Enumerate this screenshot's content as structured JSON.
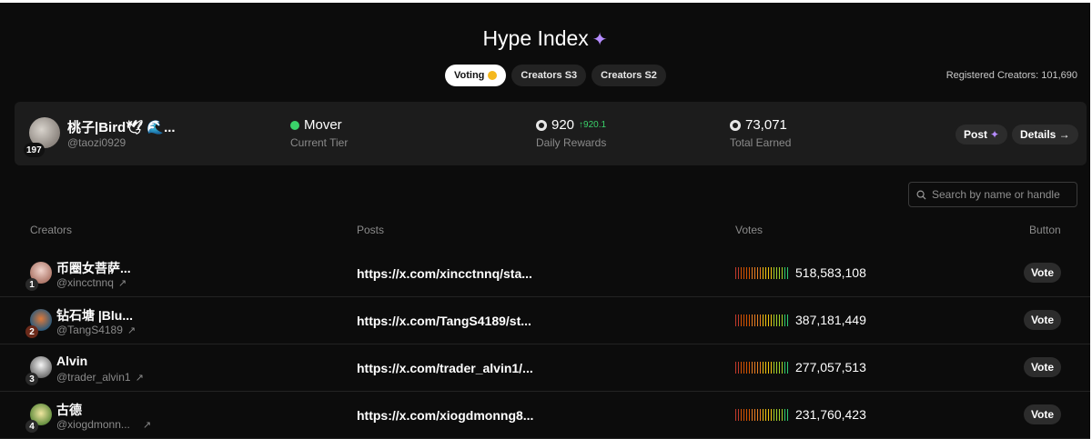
{
  "header": {
    "title": "Hype Index",
    "title_icon": "sparkle-icon"
  },
  "tabs": [
    {
      "label": "Voting",
      "active": true,
      "icon": "coin-icon"
    },
    {
      "label": "Creators S3",
      "active": false
    },
    {
      "label": "Creators S2",
      "active": false
    }
  ],
  "registered": "Registered Creators: 101,690",
  "profile": {
    "rank": "197",
    "name": "桃子|Bird🕊 🌊...",
    "handle": "@taozi0929",
    "tier_value": "Mover",
    "tier_label": "Current Tier",
    "daily_value": "920",
    "daily_delta": "↑920.1",
    "daily_label": "Daily Rewards",
    "total_value": "73,071",
    "total_label": "Total Earned",
    "post_button": "Post",
    "details_button": "Details →"
  },
  "search": {
    "placeholder": "Search by name or handle"
  },
  "table": {
    "columns": {
      "creators": "Creators",
      "posts": "Posts",
      "votes": "Votes",
      "button": "Button"
    },
    "rows": [
      {
        "rank": "1",
        "name": "币圈女菩萨...",
        "handle": "@xincctnnq",
        "post": "https://x.com/xincctnnq/sta...",
        "votes": "518,583,108",
        "vote_label": "Vote"
      },
      {
        "rank": "2",
        "name": "钻石塘 |Blu...",
        "handle": "@TangS4189",
        "post": "https://x.com/TangS4189/st...",
        "votes": "387,181,449",
        "vote_label": "Vote"
      },
      {
        "rank": "3",
        "name": "Alvin",
        "handle": "@trader_alvin1",
        "post": "https://x.com/trader_alvin1/...",
        "votes": "277,057,513",
        "vote_label": "Vote"
      },
      {
        "rank": "4",
        "name": "古德",
        "handle": "@xiogdmonn...",
        "post": "https://x.com/xiogdmonng8...",
        "votes": "231,760,423",
        "vote_label": "Vote"
      }
    ]
  },
  "colors": {
    "background": "#0c0c0c",
    "card": "#1c1c1c",
    "accent_purple": "#b68cff",
    "positive_green": "#3ad26a",
    "bar_gradient": [
      "#c0392b",
      "#d35400",
      "#e67e22",
      "#f1c40f",
      "#a3d12a",
      "#2ecc71"
    ]
  }
}
